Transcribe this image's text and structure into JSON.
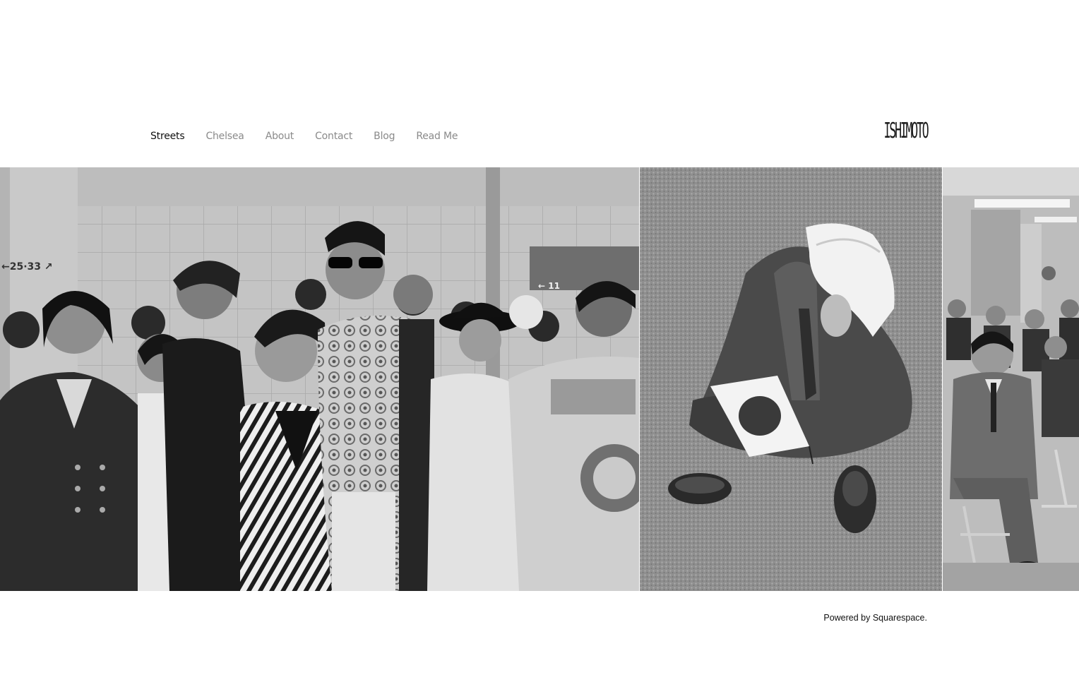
{
  "nav": {
    "items": [
      {
        "label": "Streets",
        "active": true
      },
      {
        "label": "Chelsea",
        "active": false
      },
      {
        "label": "About",
        "active": false
      },
      {
        "label": "Contact",
        "active": false
      },
      {
        "label": "Blog",
        "active": false
      },
      {
        "label": "Read Me",
        "active": false
      }
    ]
  },
  "logo": {
    "text": "ISHIMOTO"
  },
  "gallery": {
    "images": [
      {
        "icon": "street-crowd-photo"
      },
      {
        "icon": "man-with-flag-photo"
      },
      {
        "icon": "seated-men-photo"
      }
    ],
    "scene_text": {
      "sign_left": "←25·33 ↗",
      "sign_right": "← 11"
    }
  },
  "footer": {
    "powered_prefix": "Powered by ",
    "powered_link": "Squarespace",
    "powered_suffix": "."
  },
  "colors": {
    "text_active": "#111111",
    "text_muted": "#8a8a8a",
    "background": "#ffffff"
  }
}
